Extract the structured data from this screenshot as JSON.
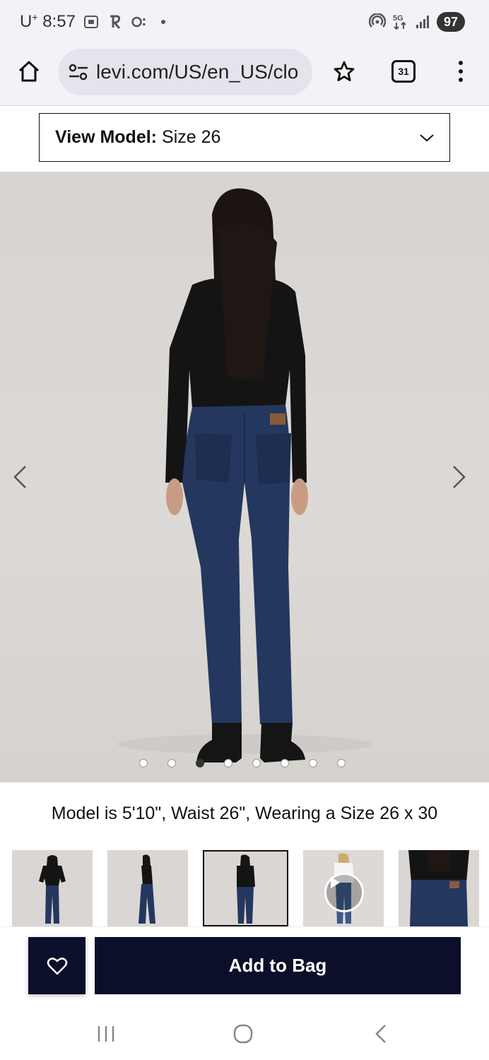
{
  "status_bar": {
    "carrier_prefix": "U",
    "carrier_plus": "+",
    "time": "8:57",
    "battery": "97",
    "network": "5G"
  },
  "browser": {
    "url": "levi.com/US/en_US/clo",
    "tabs_count": "31",
    "icons": [
      "home-icon",
      "site-settings-icon",
      "star-icon",
      "tabs-icon",
      "more-vert-icon"
    ]
  },
  "model_select": {
    "label": "View Model:",
    "value": "Size 26"
  },
  "carousel": {
    "total_images": 8,
    "active_index": 2
  },
  "model_info": "Model is 5'10\", Waist 26\", Wearing a Size 26 x 30",
  "thumbnails": [
    {
      "type": "image",
      "pose": "front"
    },
    {
      "type": "image",
      "pose": "side"
    },
    {
      "type": "image",
      "pose": "back",
      "selected": true
    },
    {
      "type": "video",
      "pose": "front-light"
    },
    {
      "type": "image",
      "pose": "back-closeup"
    }
  ],
  "actions": {
    "add_to_bag": "Add to Bag",
    "wishlist_icon": "heart-icon"
  },
  "colors": {
    "primary": "#0b0f2a",
    "background": "#ffffff",
    "chrome": "#f3f3f7"
  }
}
